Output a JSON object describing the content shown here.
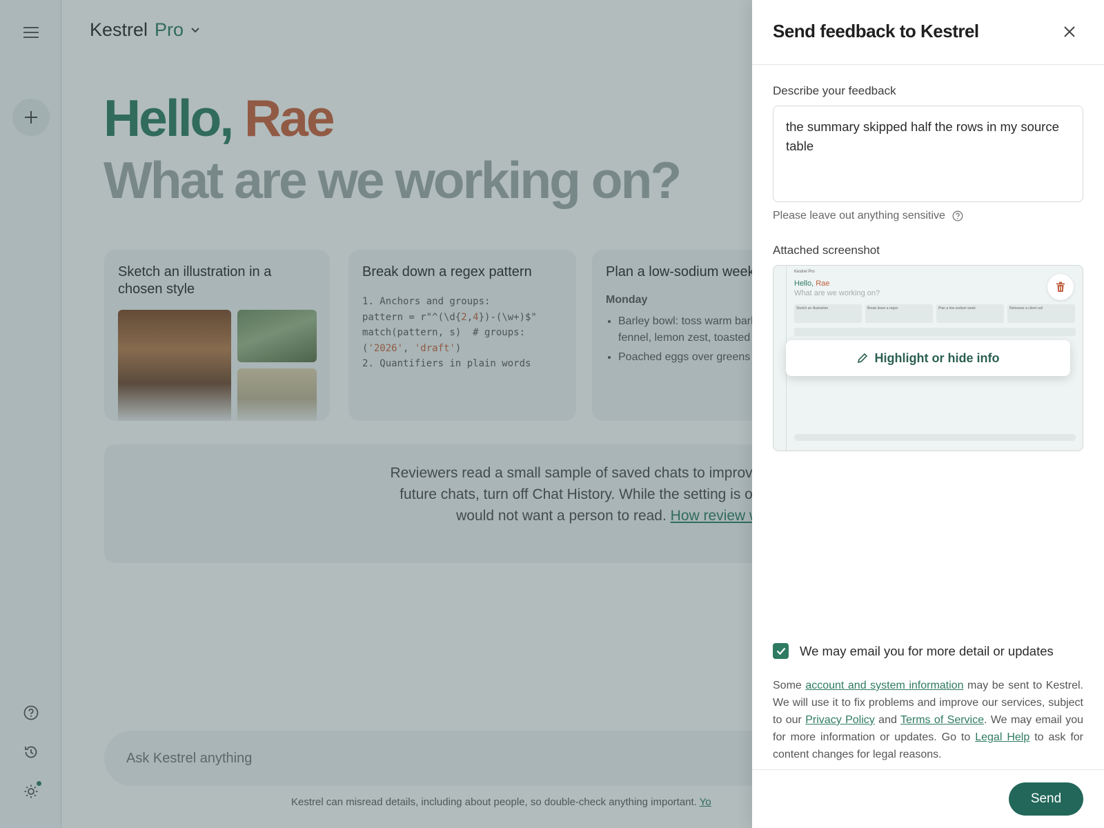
{
  "app": {
    "name": "Kestrel",
    "tier": "Pro"
  },
  "sidebar": {
    "menu_icon": "menu-icon",
    "new_chat_icon": "plus-icon",
    "bottom_icons": [
      "help-icon",
      "history-icon",
      "theme-icon"
    ]
  },
  "greeting": {
    "hello": "Hello,",
    "name": "Rae",
    "subtitle": "What are we working on?"
  },
  "cards": [
    {
      "title": "Sketch an illustration in a chosen style"
    },
    {
      "title": "Break down a regex pattern",
      "code": {
        "l1": "1. Anchors and groups:",
        "l2a": "pattern = r\"^(\\d{",
        "l2b": "2",
        "l2c": ",",
        "l2d": "4",
        "l2e": "})-(\\w+)$\"",
        "l3": "match(pattern, s)  # groups:",
        "l4a": "(",
        "l4b": "'2026'",
        "l4c": ", ",
        "l4d": "'draft'",
        "l4e": ")",
        "l5": "2. Quantifiers in plain words"
      }
    },
    {
      "title": "Plan a low-sodium week",
      "day": "Monday",
      "items": [
        "Barley bowl: toss warm barley, roasted fennel, lemon zest, toasted almonds.",
        "Poached eggs over greens"
      ]
    }
  ],
  "notice": {
    "line1": "Reviewers read a small sample of saved chats to improve Kestrel model",
    "line2": "future chats, turn off Chat History. While the setting is on, avoid enteri",
    "line3": "would not want a person to read.",
    "link": "How review works"
  },
  "composer": {
    "placeholder": "Ask Kestrel anything"
  },
  "footnote": {
    "text": "Kestrel can misread details, including about people, so double-check anything important.",
    "link": "Yo"
  },
  "feedback": {
    "title": "Send feedback to Kestrel",
    "close_icon": "close-icon",
    "describe_label": "Describe your feedback",
    "text": "the summary skipped half the rows in my source table",
    "hint": "Please leave out anything sensitive",
    "screenshot_label": "Attached screenshot",
    "thumbnail": {
      "brand": "Kestrel Pro",
      "hello": "Hello,",
      "name": "Rae",
      "subtitle": "What are we working on?",
      "cards": [
        "Sketch an illustration",
        "Break down a regex",
        "Plan a low-sodium week",
        "Rehearse a client call"
      ]
    },
    "highlight_label": "Highlight or hide info",
    "email_opt_in": "We may email you for more detail or updates",
    "email_opt_in_checked": true,
    "legal": {
      "p1": "Some",
      "link1": "account and system information",
      "p2": "may be sent to Kestrel. We will use it to fix problems and improve our services, subject to our",
      "link2": "Privacy Policy",
      "p3": "and",
      "link3": "Terms of Service",
      "p4": ". We may email you for more information or updates. Go to",
      "link4": "Legal Help",
      "p5": "to ask for content changes for legal reasons."
    },
    "send_label": "Send"
  },
  "colors": {
    "accent": "#2e7a62",
    "name_accent": "#c0603e",
    "send": "#22675a"
  }
}
